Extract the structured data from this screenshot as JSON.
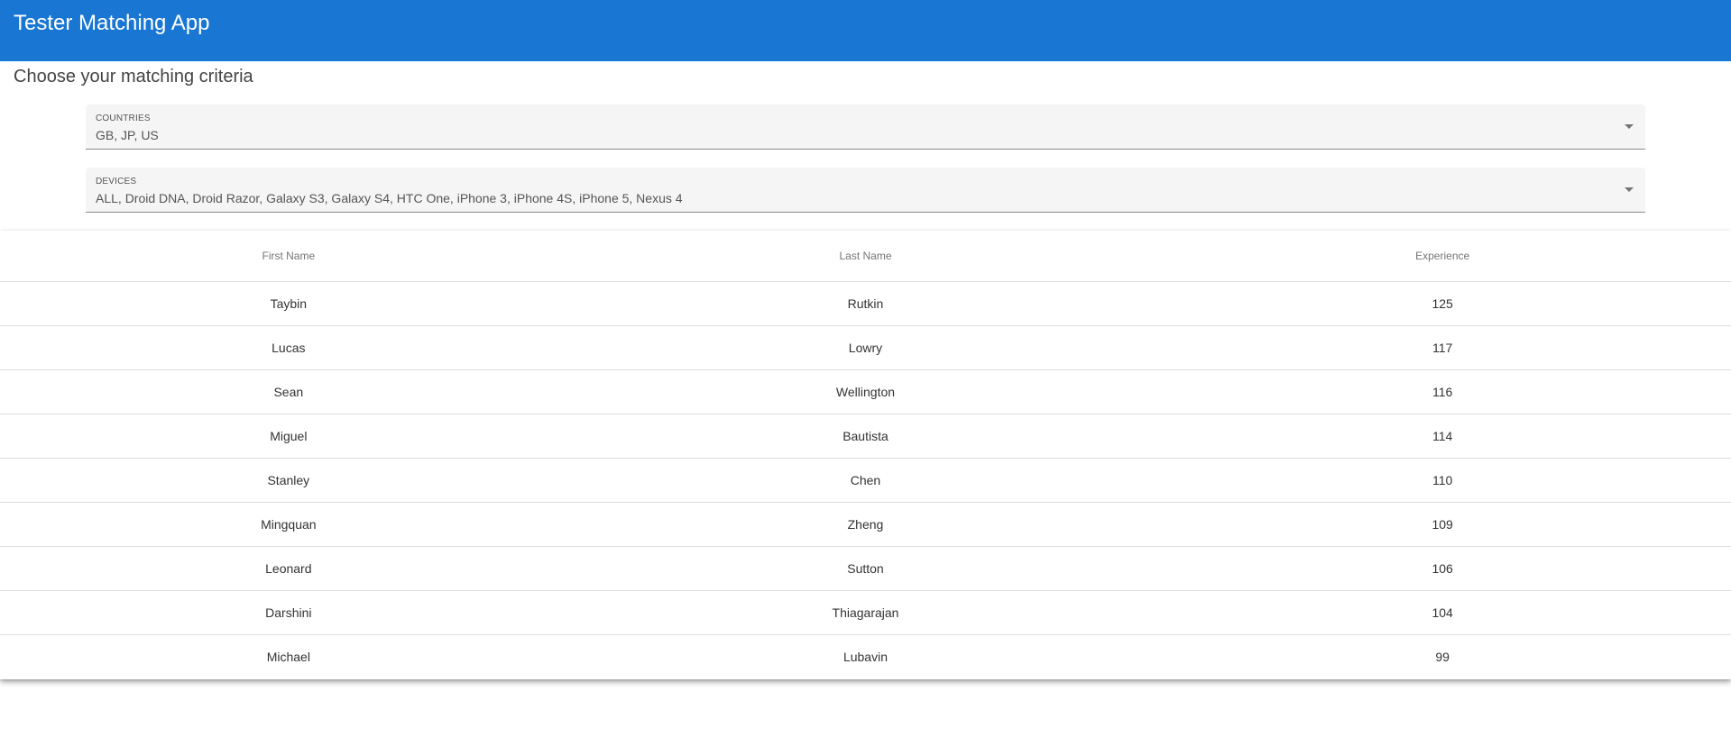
{
  "app_bar": {
    "title": "Tester Matching App"
  },
  "criteria": {
    "heading": "Choose your matching criteria",
    "countries": {
      "label": "Countries",
      "value": "GB, JP, US"
    },
    "devices": {
      "label": "Devices",
      "value": "ALL, Droid DNA, Droid Razor, Galaxy S3, Galaxy S4, HTC One, iPhone 3, iPhone 4S, iPhone 5, Nexus 4"
    }
  },
  "table": {
    "headers": [
      "First Name",
      "Last Name",
      "Experience"
    ],
    "rows": [
      [
        "Taybin",
        "Rutkin",
        "125"
      ],
      [
        "Lucas",
        "Lowry",
        "117"
      ],
      [
        "Sean",
        "Wellington",
        "116"
      ],
      [
        "Miguel",
        "Bautista",
        "114"
      ],
      [
        "Stanley",
        "Chen",
        "110"
      ],
      [
        "Mingquan",
        "Zheng",
        "109"
      ],
      [
        "Leonard",
        "Sutton",
        "106"
      ],
      [
        "Darshini",
        "Thiagarajan",
        "104"
      ],
      [
        "Michael",
        "Lubavin",
        "99"
      ]
    ]
  },
  "colors": {
    "app_bar": "#1976d2",
    "field_background": "#f5f5f5"
  },
  "icons": {
    "dropdown": "arrow-drop-down-icon"
  }
}
